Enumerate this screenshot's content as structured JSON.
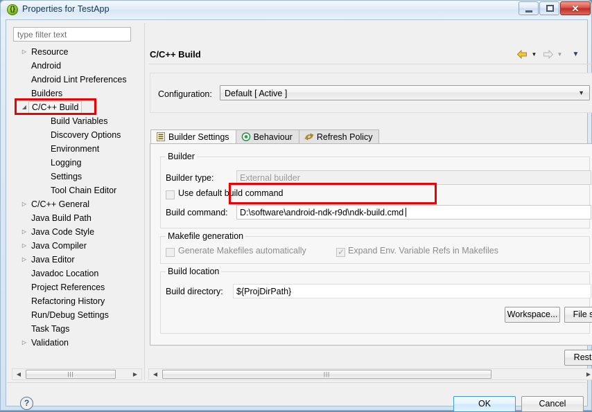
{
  "window": {
    "title": "Properties for TestApp",
    "icon": "properties-braces-icon",
    "minimize_label": "Minimize",
    "maximize_label": "Maximize",
    "close_label": "✕"
  },
  "sidebar": {
    "filter_placeholder": "type filter text",
    "filter_value": "",
    "items": [
      {
        "label": "Resource",
        "level": 0,
        "arrow": "▷",
        "selected": false
      },
      {
        "label": "Android",
        "level": 0,
        "arrow": "",
        "selected": false
      },
      {
        "label": "Android Lint Preferences",
        "level": 0,
        "arrow": "",
        "selected": false
      },
      {
        "label": "Builders",
        "level": 0,
        "arrow": "",
        "selected": false
      },
      {
        "label": "C/C++ Build",
        "level": 0,
        "arrow": "◢",
        "selected": true
      },
      {
        "label": "Build Variables",
        "level": 1,
        "arrow": "",
        "selected": false
      },
      {
        "label": "Discovery Options",
        "level": 1,
        "arrow": "",
        "selected": false
      },
      {
        "label": "Environment",
        "level": 1,
        "arrow": "",
        "selected": false
      },
      {
        "label": "Logging",
        "level": 1,
        "arrow": "",
        "selected": false
      },
      {
        "label": "Settings",
        "level": 1,
        "arrow": "",
        "selected": false
      },
      {
        "label": "Tool Chain Editor",
        "level": 1,
        "arrow": "",
        "selected": false
      },
      {
        "label": "C/C++ General",
        "level": 0,
        "arrow": "▷",
        "selected": false
      },
      {
        "label": "Java Build Path",
        "level": 0,
        "arrow": "",
        "selected": false
      },
      {
        "label": "Java Code Style",
        "level": 0,
        "arrow": "▷",
        "selected": false
      },
      {
        "label": "Java Compiler",
        "level": 0,
        "arrow": "▷",
        "selected": false
      },
      {
        "label": "Java Editor",
        "level": 0,
        "arrow": "▷",
        "selected": false
      },
      {
        "label": "Javadoc Location",
        "level": 0,
        "arrow": "",
        "selected": false
      },
      {
        "label": "Project References",
        "level": 0,
        "arrow": "",
        "selected": false
      },
      {
        "label": "Refactoring History",
        "level": 0,
        "arrow": "",
        "selected": false
      },
      {
        "label": "Run/Debug Settings",
        "level": 0,
        "arrow": "",
        "selected": false
      },
      {
        "label": "Task Tags",
        "level": 0,
        "arrow": "",
        "selected": false
      },
      {
        "label": "Validation",
        "level": 0,
        "arrow": "▷",
        "selected": false
      }
    ],
    "scroll_left_glyph": "◀",
    "scroll_right_glyph": "▶",
    "thumb_grip": "|||"
  },
  "page": {
    "title": "C/C++ Build",
    "nav_back": "back-arrow",
    "nav_forward": "forward-arrow",
    "nav_menu": "view-menu-caret"
  },
  "configuration": {
    "label": "Configuration:",
    "value": "Default  [ Active ]",
    "caret": "▼"
  },
  "tabs": [
    {
      "label": "Builder Settings",
      "icon": "list-lines-icon",
      "active": true
    },
    {
      "label": "Behaviour",
      "icon": "target-circle-icon",
      "active": false
    },
    {
      "label": "Refresh Policy",
      "icon": "refresh-arrows-icon",
      "active": false
    }
  ],
  "builder_group": {
    "caption": "Builder",
    "builder_type_label": "Builder type:",
    "builder_type_value": "External builder",
    "use_default_label": "Use default build command",
    "use_default_checked": false,
    "build_command_label": "Build command:",
    "build_command_value": "D:\\software\\android-ndk-r9d\\ndk-build.cmd"
  },
  "makefile_group": {
    "caption": "Makefile generation",
    "generate_label": "Generate Makefiles automatically",
    "generate_checked": false,
    "expand_label": "Expand Env. Variable Refs in Makefiles",
    "expand_checked": true,
    "check_glyph": "✓"
  },
  "buildloc_group": {
    "caption": "Build location",
    "build_dir_label": "Build directory:",
    "build_dir_value": "${ProjDirPath}",
    "workspace_button": "Workspace...",
    "file_button": "File s"
  },
  "footer": {
    "restore_button": "Resto",
    "help_icon": "?",
    "ok_button": "OK",
    "cancel_button": "Cancel"
  },
  "page_scrollbar": {
    "left_glyph": "◀",
    "right_glyph": "▶",
    "thumb_grip": "|||"
  },
  "annotations": {
    "color": "#ee0000",
    "boxes": [
      "sidebar-cpp-build-highlight",
      "build-command-field-highlight"
    ]
  }
}
